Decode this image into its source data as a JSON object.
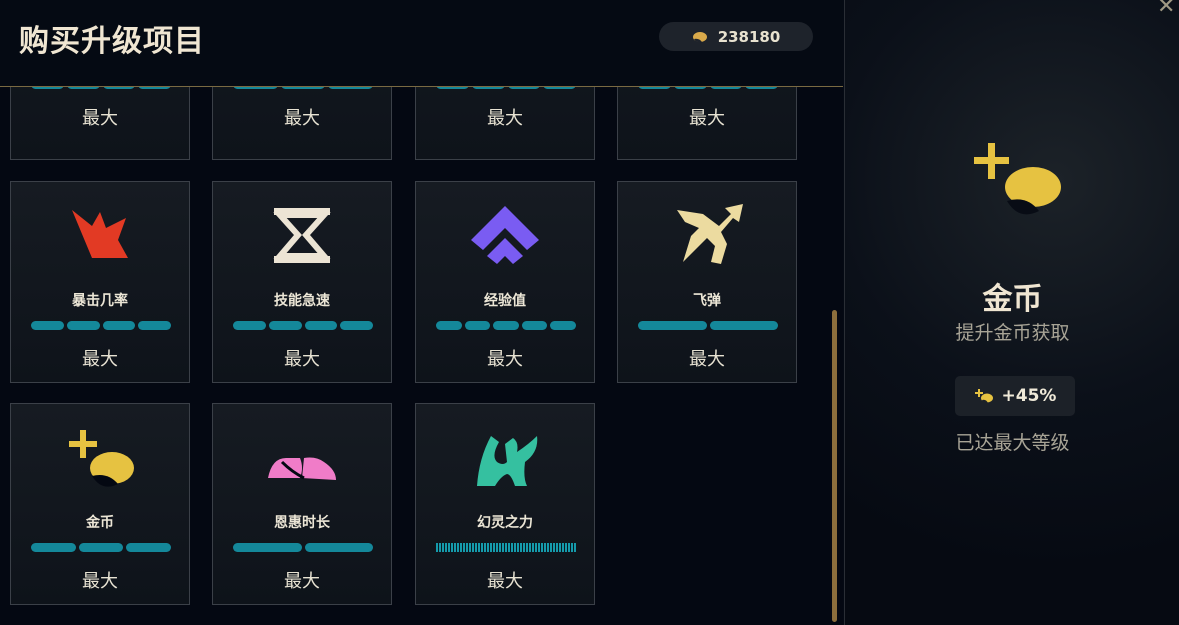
{
  "header": {
    "title": "购买升级项目",
    "currency_value": "238180"
  },
  "top_row": [
    {
      "pips": 4,
      "max_label": "最大"
    },
    {
      "pips": 3,
      "max_label": "最大"
    },
    {
      "pips": 4,
      "max_label": "最大"
    },
    {
      "pips": 4,
      "max_label": "最大"
    }
  ],
  "upgrades": [
    {
      "name": "暴击几率",
      "icon": "crit-burst-icon",
      "color": "#e23a24",
      "pips": 4,
      "max_label": "最大"
    },
    {
      "name": "技能急速",
      "icon": "hourglass-icon",
      "color": "#ece4d4",
      "pips": 4,
      "max_label": "最大"
    },
    {
      "name": "经验值",
      "icon": "chevron-up-icon",
      "color": "#7a5cf2",
      "pips": 5,
      "max_label": "最大"
    },
    {
      "name": "飞弹",
      "icon": "split-arrow-icon",
      "color": "#ecdba0",
      "pips": 2,
      "max_label": "最大"
    },
    {
      "name": "金币",
      "icon": "gold-plus-icon",
      "color": "#e6c241",
      "pips": 3,
      "max_label": "最大"
    },
    {
      "name": "恩惠时长",
      "icon": "pink-boots-icon",
      "color": "#f07cc8",
      "pips": 2,
      "max_label": "最大"
    },
    {
      "name": "幻灵之力",
      "icon": "spirit-rabbit-icon",
      "color": "#35c0a0",
      "pips": 1,
      "fine": true,
      "max_label": "最大"
    }
  ],
  "detail": {
    "title": "金币",
    "subtitle": "提升金币获取",
    "bonus": "+45%",
    "status": "已达最大等级"
  }
}
